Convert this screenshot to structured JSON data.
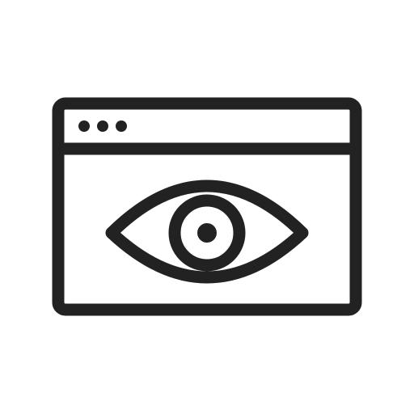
{
  "icon": {
    "name": "browser-window-eye-icon",
    "stroke_color": "#222222",
    "background_color": "#ffffff",
    "window_dots": 3
  }
}
